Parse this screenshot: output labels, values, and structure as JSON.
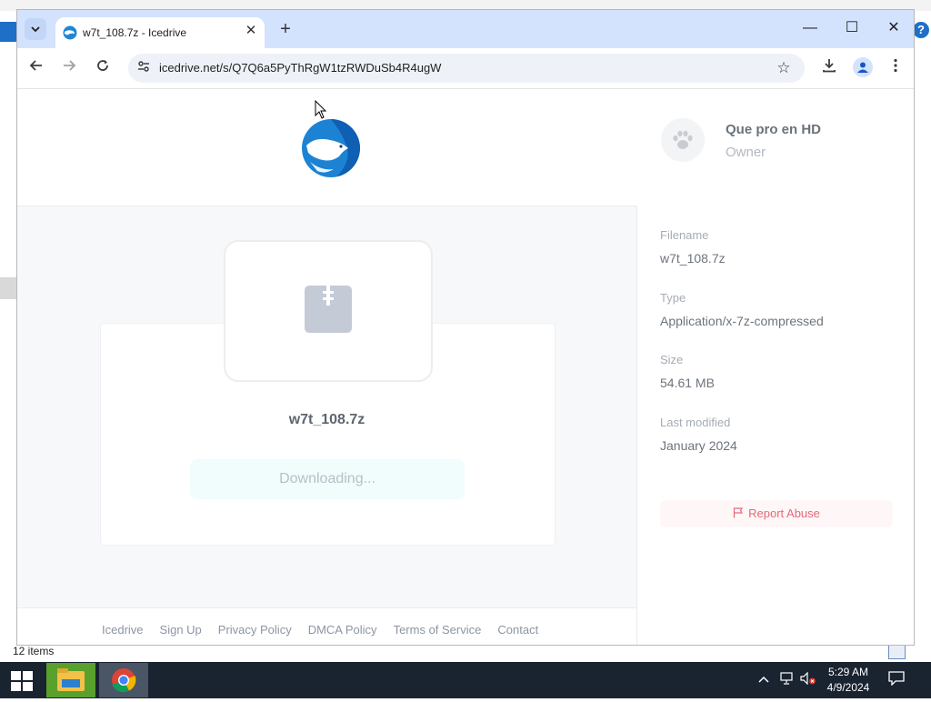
{
  "browser": {
    "tab_title": "w7t_108.7z - Icedrive",
    "url": "icedrive.net/s/Q7Q6a5PyThRgW1tzRWDuSb4R4ugW",
    "new_tab_symbol": "+",
    "minimize_symbol": "—",
    "maximize_symbol": "☐",
    "close_symbol": "✕"
  },
  "file": {
    "name": "w7t_108.7z",
    "status": "Downloading..."
  },
  "owner": {
    "name": "Que pro en HD",
    "role": "Owner"
  },
  "details": [
    {
      "label": "Filename",
      "value": "w7t_108.7z"
    },
    {
      "label": "Type",
      "value": "Application/x-7z-compressed"
    },
    {
      "label": "Size",
      "value": "54.61 MB"
    },
    {
      "label": "Last modified",
      "value": "January 2024"
    }
  ],
  "report_label": "Report Abuse",
  "footer_links": [
    "Icedrive",
    "Sign Up",
    "Privacy Policy",
    "DMCA Policy",
    "Terms of Service",
    "Contact"
  ],
  "explorer": {
    "items_count": "12 items"
  },
  "taskbar": {
    "time": "5:29 AM",
    "date": "4/9/2024"
  },
  "colors": {
    "tabstrip": "#d3e3fd",
    "accent_blue": "#1e6fc8",
    "report_red": "#e46a78",
    "taskbar": "#1a2330"
  }
}
